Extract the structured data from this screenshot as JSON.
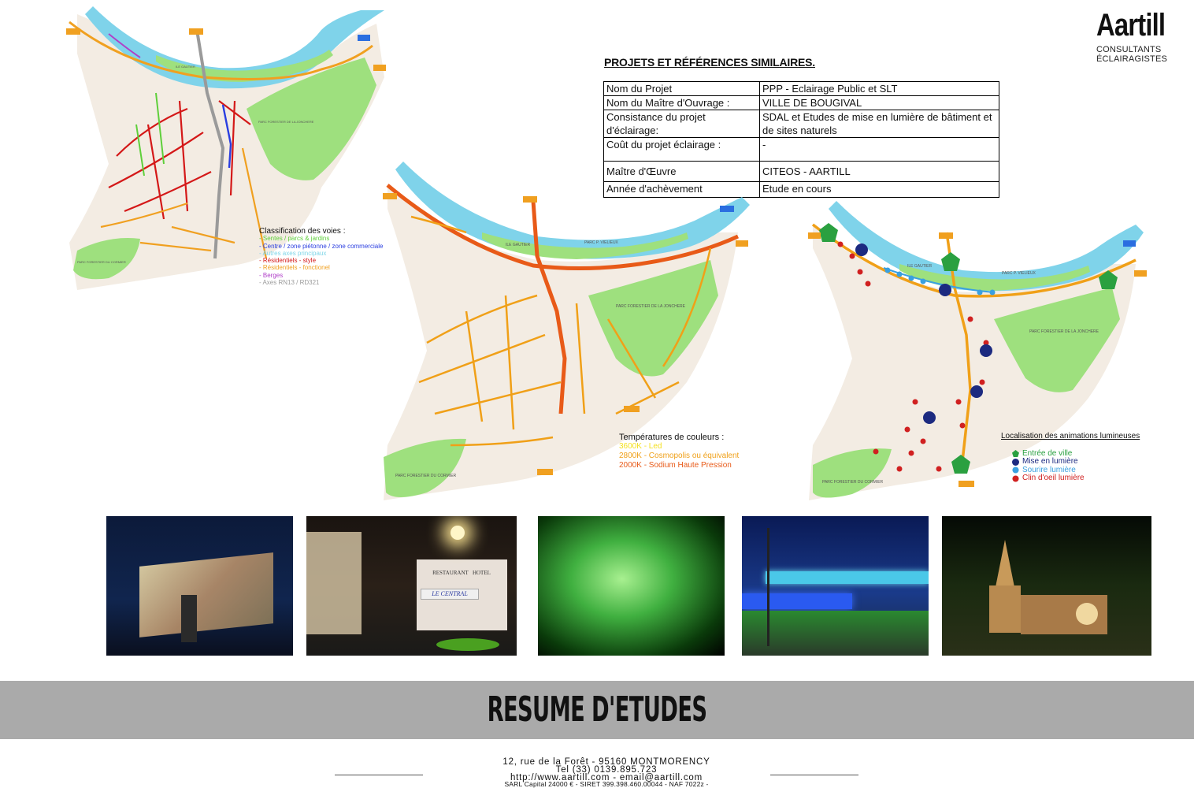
{
  "logo": {
    "name": "Aartill",
    "line1": "CONSULTANTS",
    "line2": "ÉCLAIRAGISTES"
  },
  "section_title": "PROJETS ET RÉFÉRENCES SIMILAIRES.",
  "project_table": [
    {
      "label": "Nom du Projet",
      "value": "PPP - Eclairage Public et SLT"
    },
    {
      "label": "Nom du Maître d'Ouvrage :",
      "value": "VILLE DE BOUGIVAL"
    },
    {
      "label": "Consistance du projet d'éclairage:",
      "value": "SDAL et Etudes de mise en lumière de bâtiment et de sites naturels"
    },
    {
      "label": "Coût du projet éclairage :",
      "value": "-"
    },
    {
      "label": "Maître d'Œuvre",
      "value": "CITEOS - AARTILL"
    },
    {
      "label": "Année d'achèvement",
      "value": "Etude en cours"
    }
  ],
  "map_labels": {
    "parc_jonchere": "PARC FORESTIER DE LA JONCHERE",
    "parc_cormier": "PARC FORESTIER DU CORMIER",
    "ile_gautier": "ILE GAUTIER",
    "ile_chaussee": "ILE DE LA CHAUSSEE",
    "parc_vielieux": "PARC P. VIELIEUX"
  },
  "map1_legend": {
    "title": "Classification des voies :",
    "items": [
      {
        "label": "- Sentes / parcs & jardins",
        "color": "#5ecf3a"
      },
      {
        "label": "- Centre / zone piétonne / zone  commerciale",
        "color": "#2a3ee0"
      },
      {
        "label": "- Autres axes principaux",
        "color": "#7fd6e8"
      },
      {
        "label": "- Résidentiels - style",
        "color": "#d41818"
      },
      {
        "label": "- Résidentiels - fonctionel",
        "color": "#f0a020"
      },
      {
        "label": "- Berges",
        "color": "#b040c8"
      },
      {
        "label": "- Axes RN13 / RD321",
        "color": "#9a9a9a"
      }
    ]
  },
  "map2_legend": {
    "title": "Températures de couleurs :",
    "items": [
      {
        "label": "3600K - Led",
        "color": "#f4e020"
      },
      {
        "label": "2800K - Cosmopolis ou équivalent",
        "color": "#f0a018"
      },
      {
        "label": "2000K - Sodium Haute Pression",
        "color": "#e85a18"
      }
    ]
  },
  "map3_legend": {
    "title": "Localisation des animations lumineuses",
    "items": [
      {
        "label": "Entrée de ville",
        "color": "#2aa040",
        "shape": "pentagon"
      },
      {
        "label": "Mise en lumière",
        "color": "#1c2a80",
        "shape": "building"
      },
      {
        "label": "Sourire lumière",
        "color": "#3aa0e0",
        "shape": "dot"
      },
      {
        "label": "Clin d'oeil lumière",
        "color": "#d02020",
        "shape": "dot"
      }
    ]
  },
  "photos": [
    {
      "label": "fresque-nocturne"
    },
    {
      "label": "restaurant-le-central"
    },
    {
      "label": "eau-verte"
    },
    {
      "label": "pont-bleu"
    },
    {
      "label": "eglise"
    }
  ],
  "photo_signs": {
    "restaurant": "LE CENTRAL",
    "restaurant_top": "RESTAURANT",
    "hotel": "HOTEL"
  },
  "banner_title": "RESUME D'ETUDES",
  "footer": {
    "address": "12, rue de la Forêt - 95160 MONTMORENCY",
    "tel": "Tel  (33) 0139.895.723",
    "web": "http://www.aartill.com - email@aartill.com",
    "legal": "SARL Capital 24000 € - SIRET 399.398.460.00044 - NAF 7022z -"
  }
}
